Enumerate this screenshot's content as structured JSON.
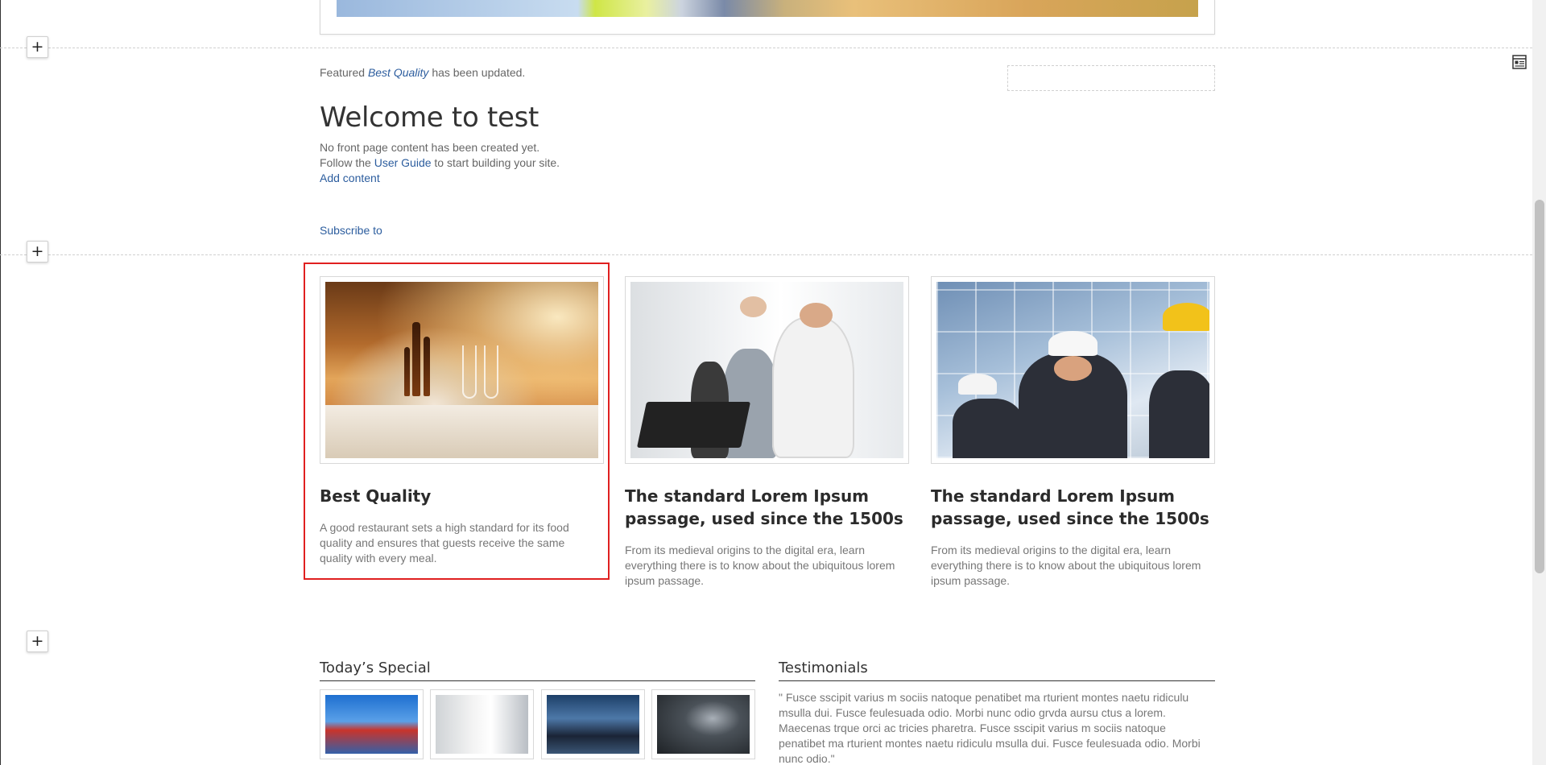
{
  "status": {
    "prefix": "Featured",
    "link": "Best Quality",
    "suffix": "has been updated."
  },
  "welcome": {
    "title": "Welcome to test",
    "line1": "No front page content has been created yet.",
    "line2_prefix": "Follow the",
    "line2_link": "User Guide",
    "line2_suffix": "to start building your site.",
    "add_content": "Add content"
  },
  "subscribe": "Subscribe to",
  "add_section_symbol": "+",
  "cards": [
    {
      "title": "Best Quality",
      "text": "A good restaurant sets a high standard for its food quality and ensures that guests receive the same quality with every meal."
    },
    {
      "title": "The standard Lorem Ipsum passage, used since the 1500s",
      "text": "From its medieval origins to the digital era, learn everything there is to know about the ubiquitous lorem ipsum passage."
    },
    {
      "title": "The standard Lorem Ipsum passage, used since the 1500s",
      "text": "From its medieval origins to the digital era, learn everything there is to know about the ubiquitous lorem ipsum passage."
    }
  ],
  "todays_special": {
    "title": "Today’s Special"
  },
  "testimonials": {
    "title": "Testimonials",
    "text": "\" Fusce sscipit varius m sociis natoque penatibet ma rturient montes naetu ridiculu msulla dui. Fusce feulesuada odio. Morbi nunc odio grvda aursu ctus a lorem. Maecenas trque orci ac tricies pharetra. Fusce sscipit varius m sociis natoque penatibet ma rturient montes naetu ridiculu msulla dui. Fusce feulesuada odio. Morbi nunc odio.\""
  },
  "colors": {
    "link": "#2c5d9e",
    "highlight": "#e02020",
    "heading": "#2b2b2b"
  },
  "icons": {
    "add_section": "plus-icon",
    "layout_toggle": "layout-panel-icon"
  }
}
